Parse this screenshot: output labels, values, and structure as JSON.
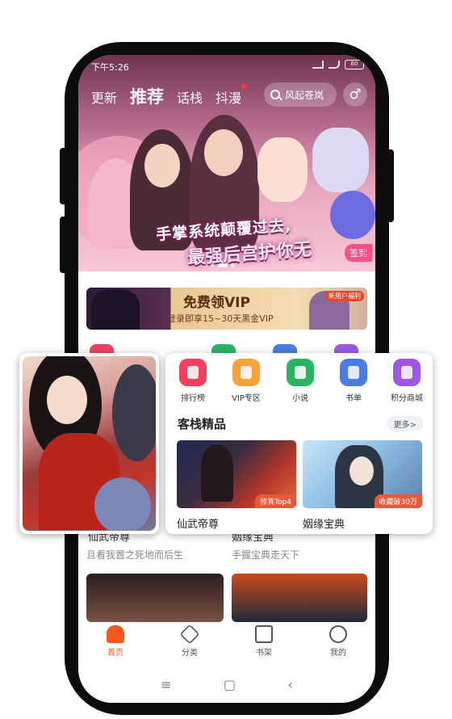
{
  "status_bar": {
    "time": "下午5:26",
    "battery": "60"
  },
  "top_nav": {
    "tabs": [
      {
        "label": "更新",
        "active": false
      },
      {
        "label": "推荐",
        "active": true
      },
      {
        "label": "话栈",
        "active": false
      },
      {
        "label": "抖漫",
        "active": false,
        "dot": true
      }
    ],
    "search_placeholder": "风起苍岚",
    "gender_icon": "♂"
  },
  "hero_banner": {
    "title_line1": "手掌系统颠覆过去,",
    "title_line2": "最强后宫护你无",
    "checkin": "签到"
  },
  "vip_banner": {
    "title": "免费领VIP",
    "subtitle": "登录即享15~30天黑金VIP",
    "tag": "新用户福利"
  },
  "quick_menu": [
    {
      "label": "排行榜",
      "icon": "ranking-icon",
      "color": "#f2405f"
    },
    {
      "label": "VIP专区",
      "icon": "vip-crown-icon",
      "color": "#f7a23b"
    },
    {
      "label": "小说",
      "icon": "book-icon",
      "color": "#28b463"
    },
    {
      "label": "书单",
      "icon": "booklist-icon",
      "color": "#4b7be5"
    },
    {
      "label": "积分商城",
      "icon": "shop-icon",
      "color": "#9b59e6"
    }
  ],
  "section": {
    "title": "客栈精品",
    "more": "更多>",
    "books": [
      {
        "title": "仙武帝尊",
        "badge": "修真Top4",
        "subtitle": "且看我置之死地而后生"
      },
      {
        "title": "姻缘宝典",
        "badge": "收藏破30万",
        "subtitle": "手握宝典走天下"
      }
    ]
  },
  "tab_bar": [
    {
      "label": "首页",
      "icon": "home-icon",
      "active": true
    },
    {
      "label": "分类",
      "icon": "category-icon",
      "active": false
    },
    {
      "label": "书架",
      "icon": "bookshelf-icon",
      "active": false
    },
    {
      "label": "我的",
      "icon": "profile-icon",
      "active": false
    }
  ],
  "system_nav": {
    "menu": "≡",
    "home": "▢",
    "back": "‹"
  }
}
